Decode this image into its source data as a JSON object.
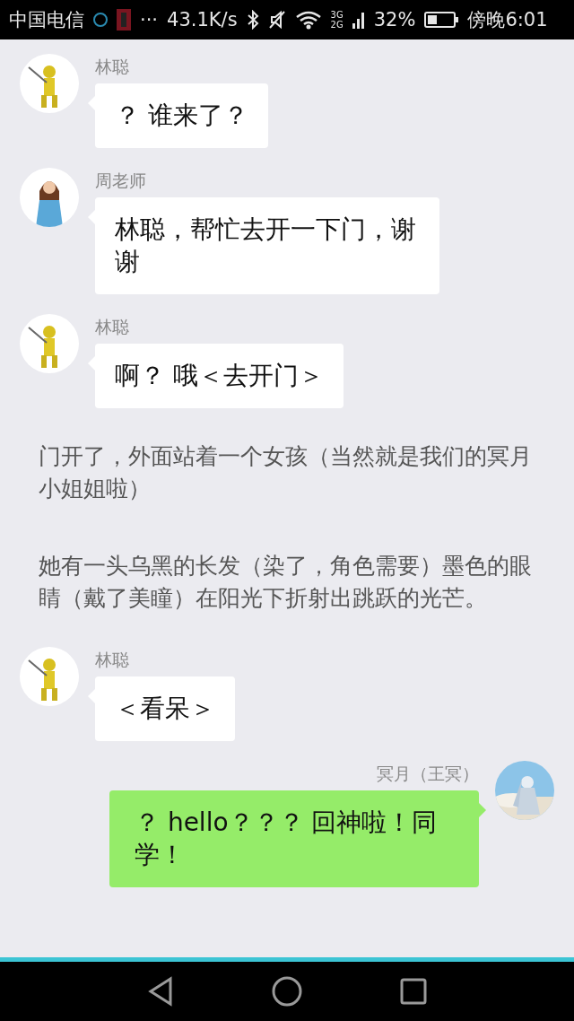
{
  "status_bar": {
    "carrier": "中国电信",
    "more": "···",
    "speed": "43.1K/s",
    "network_top": "3G",
    "network_bottom": "2G",
    "battery": "32%",
    "time": "傍晚6:01"
  },
  "messages": [
    {
      "kind": "incoming",
      "avatar": {
        "kind": "hero"
      },
      "sender": "林聪",
      "text": "？ 谁来了？"
    },
    {
      "kind": "incoming",
      "avatar": {
        "kind": "teacher"
      },
      "sender": "周老师",
      "text": "林聪，帮忙去开一下门，谢谢"
    },
    {
      "kind": "incoming",
      "avatar": {
        "kind": "hero"
      },
      "sender": "林聪",
      "text": "啊？ 哦＜去开门＞"
    },
    {
      "kind": "narration",
      "text": "门开了，外面站着一个女孩（当然就是我们的冥月小姐姐啦）"
    },
    {
      "kind": "narration",
      "text": "她有一头乌黑的长发（染了，角色需要）墨色的眼睛（戴了美瞳）在阳光下折射出跳跃的光芒。"
    },
    {
      "kind": "incoming",
      "avatar": {
        "kind": "hero"
      },
      "sender": "林聪",
      "text": "＜看呆＞"
    },
    {
      "kind": "outgoing",
      "avatar": {
        "kind": "girl"
      },
      "sender": "冥月（王冥）",
      "text": "？ hello？？？ 回神啦！同学！"
    }
  ]
}
